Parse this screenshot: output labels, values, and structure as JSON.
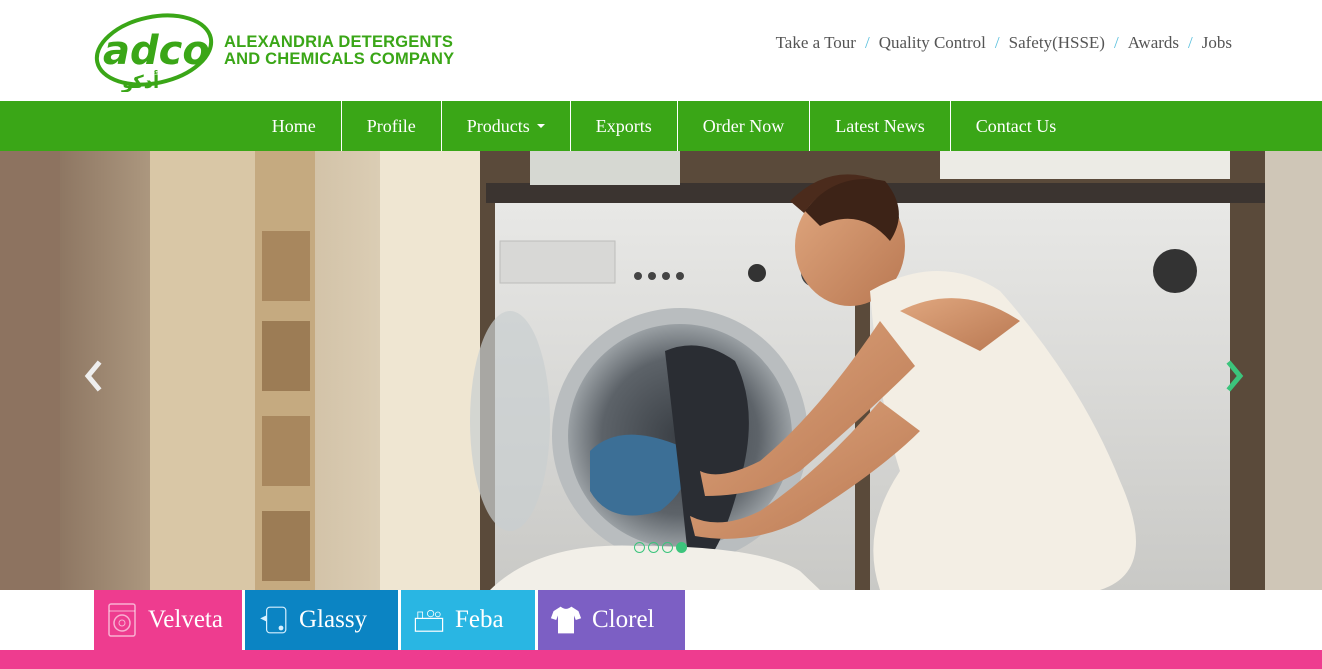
{
  "brand": {
    "logo_latin": "adco",
    "logo_arabic": "أدكو",
    "name_line1": "ALEXANDRIA DETERGENTS",
    "name_line2": "AND CHEMICALS COMPANY",
    "color": "#3aa617"
  },
  "top_links": [
    {
      "label": "Take a Tour"
    },
    {
      "label": "Quality Control"
    },
    {
      "label": "Safety(HSSE)"
    },
    {
      "label": "Awards"
    },
    {
      "label": "Jobs"
    }
  ],
  "top_link_separator": "/",
  "nav": [
    {
      "label": "Home"
    },
    {
      "label": "Profile"
    },
    {
      "label": "Products"
    },
    {
      "label": "Exports"
    },
    {
      "label": "Order Now"
    },
    {
      "label": "Latest News"
    },
    {
      "label": "Contact Us"
    }
  ],
  "slider": {
    "prev_icon": "chevron-left-icon",
    "next_icon": "chevron-right-icon",
    "slide_count": 4,
    "active_slide": 4
  },
  "product_tabs": [
    {
      "label": "Velveta",
      "color": "#ee3c8f",
      "icon": "washing-machine-icon"
    },
    {
      "label": "Glassy",
      "color": "#0b84c3",
      "icon": "window-spray-icon"
    },
    {
      "label": "Feba",
      "color": "#29b6e3",
      "icon": "sink-dishes-icon"
    },
    {
      "label": "Clorel",
      "color": "#7c5fc4",
      "icon": "tshirt-icon"
    }
  ],
  "accent_bar_color": "#ee3c8f"
}
